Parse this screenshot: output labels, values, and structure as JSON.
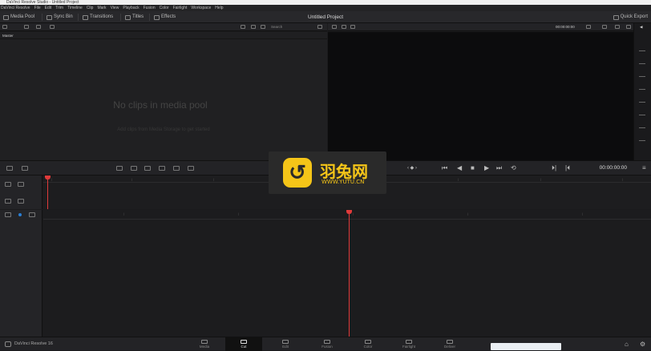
{
  "window": {
    "title": "DaVinci Resolve Studio - Untitled Project"
  },
  "menu": [
    "DaVinci Resolve",
    "File",
    "Edit",
    "Trim",
    "Timeline",
    "Clip",
    "Mark",
    "View",
    "Playback",
    "Fusion",
    "Color",
    "Fairlight",
    "Workspace",
    "Help"
  ],
  "toolbar": {
    "media_pool": "Media Pool",
    "sync_bin": "Sync Bin",
    "transitions": "Transitions",
    "titles": "Titles",
    "effects": "Effects",
    "project_title": "Untitled Project",
    "quick_export": "Quick Export"
  },
  "media_pool": {
    "search_placeholder": "Search",
    "bin_name": "Master",
    "empty_title": "No clips in media pool",
    "empty_hint": "Add clips from Media Storage to get started"
  },
  "viewer": {
    "timecode": "00:00:00:00"
  },
  "transport": {
    "timecode": "00:00:00:00"
  },
  "pages": [
    {
      "label": "Media",
      "icon": "media-page-icon"
    },
    {
      "label": "Cut",
      "icon": "cut-page-icon",
      "active": true
    },
    {
      "label": "Edit",
      "icon": "edit-page-icon"
    },
    {
      "label": "Fusion",
      "icon": "fusion-page-icon"
    },
    {
      "label": "Color",
      "icon": "color-page-icon"
    },
    {
      "label": "Fairlight",
      "icon": "fairlight-page-icon"
    },
    {
      "label": "Deliver",
      "icon": "deliver-page-icon"
    }
  ],
  "app_name": "DaVinci Resolve 16",
  "watermark": {
    "name": "羽兔网",
    "url": "WWW.YUTU.CN"
  },
  "colors": {
    "playhead": "#e03a3a",
    "watermark": "#f5c518"
  }
}
